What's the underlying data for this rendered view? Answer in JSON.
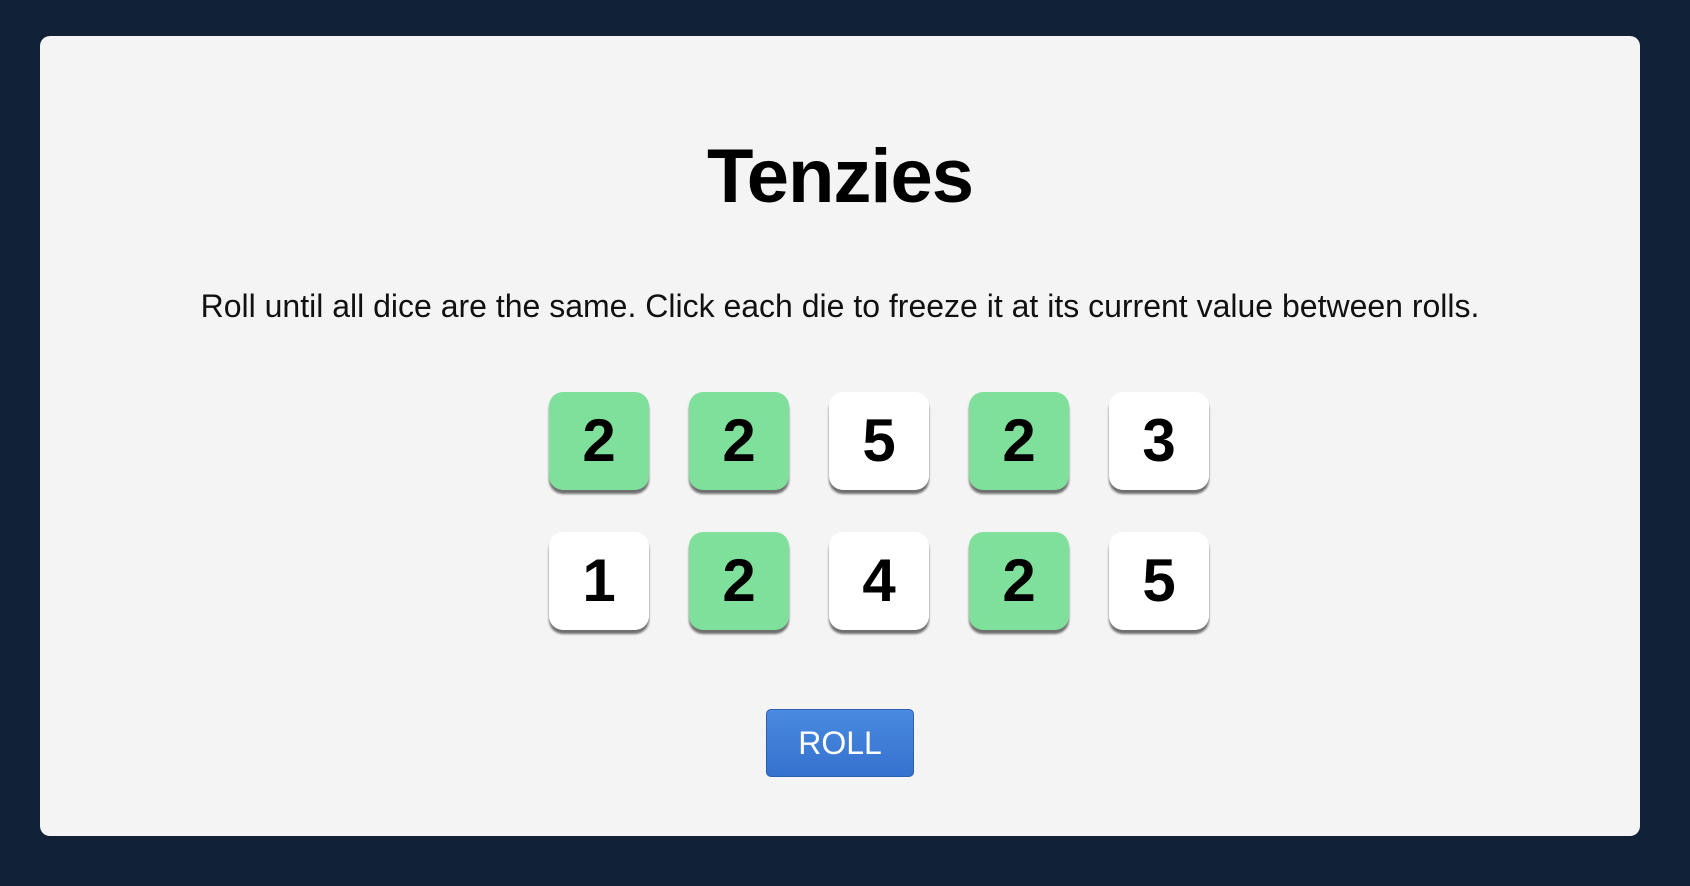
{
  "game": {
    "title": "Tenzies",
    "instructions": "Roll until all dice are the same. Click each die to freeze it at its current value between rolls.",
    "roll_label": "ROLL"
  },
  "colors": {
    "background": "#122236",
    "panel": "#f4f4f4",
    "held_die": "#7fe09b",
    "free_die": "#ffffff",
    "button": "#3a7bd5"
  },
  "dice": [
    {
      "value": "2",
      "held": true
    },
    {
      "value": "2",
      "held": true
    },
    {
      "value": "5",
      "held": false
    },
    {
      "value": "2",
      "held": true
    },
    {
      "value": "3",
      "held": false
    },
    {
      "value": "1",
      "held": false
    },
    {
      "value": "2",
      "held": true
    },
    {
      "value": "4",
      "held": false
    },
    {
      "value": "2",
      "held": true
    },
    {
      "value": "5",
      "held": false
    }
  ]
}
